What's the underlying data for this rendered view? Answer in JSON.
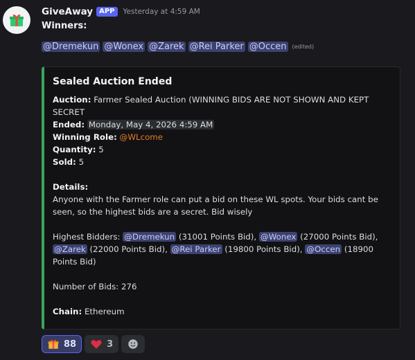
{
  "message": {
    "username": "GiveAway",
    "badge": "APP",
    "timestamp": "Yesterday at 4:59 AM",
    "winners_label": "Winners:",
    "mentions": [
      "@Dremekun",
      "@Wonex",
      "@Zarek",
      "@Rei Parker",
      "@Occen"
    ],
    "edited": "(edited)"
  },
  "embed": {
    "title": "Sealed Auction Ended",
    "auction_label": "Auction:",
    "auction_line1": "Farmer Sealed Auction (WINNING BIDS ARE NOT SHOWN AND KEPT",
    "auction_line2": "SECRET",
    "ended_label": "Ended:",
    "ended_value": "Monday, May 4, 2026 4:59 AM",
    "role_label": "Winning Role:",
    "role_value": "@WLcome",
    "quantity_label": "Quantity:",
    "quantity_value": "5",
    "sold_label": "Sold:",
    "sold_value": "5",
    "details_label": "Details:",
    "details_line1": "Anyone with the Farmer role can put a bid on these WL spots. Your bids cant be",
    "details_line2": "seen, so the highest bids are a secret. Bid wisely",
    "bidders_label": "Highest Bidders: ",
    "bidders": [
      {
        "name": "@Dremekun",
        "bid": " (31001 Points Bid), "
      },
      {
        "name": "@Wonex",
        "bid": " (27000 Points Bid),"
      },
      {
        "name": "@Zarek",
        "bid": " (22000 Points Bid), "
      },
      {
        "name": "@Rei Parker",
        "bid": " (19800 Points Bid), "
      },
      {
        "name": "@Occen",
        "bid": " (18900"
      }
    ],
    "bidders_tail": "Points Bid)",
    "num_bids": "Number of Bids: 276",
    "chain_label": "Chain:",
    "chain_value": "Ethereum",
    "accent_color": "#3ba55c"
  },
  "reactions": [
    {
      "icon": "gift-icon",
      "count": "88",
      "active": true
    },
    {
      "icon": "heart-icon",
      "count": "3",
      "active": false
    },
    {
      "icon": "add-reaction-icon",
      "count": "",
      "active": false
    }
  ]
}
